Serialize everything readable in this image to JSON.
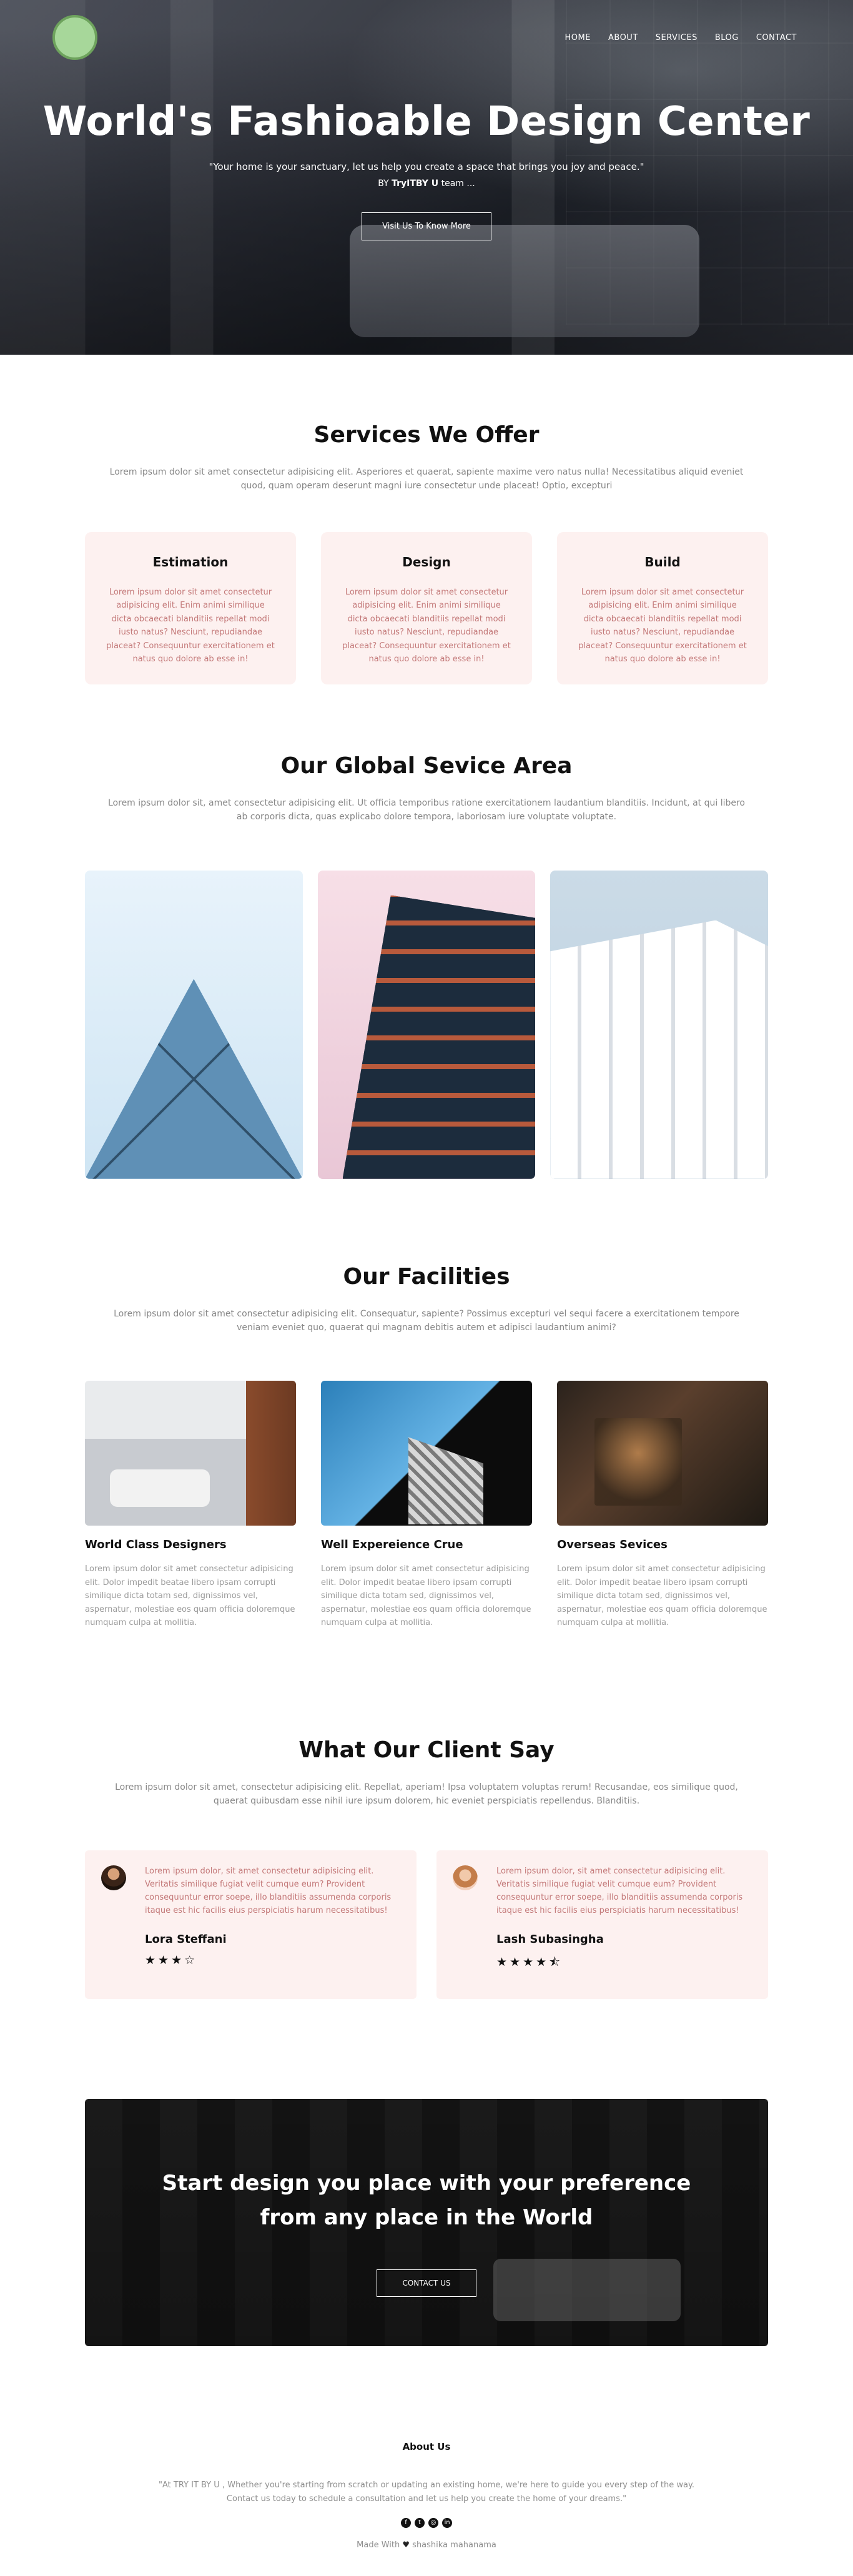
{
  "nav": {
    "logo_text": "",
    "links": [
      "HOME",
      "ABOUT",
      "SERVICES",
      "BLOG",
      "CONTACT"
    ]
  },
  "hero": {
    "title": "World's Fashioable Design Center",
    "quote": "\"Your home is your sanctuary, let us help you create a space that brings you joy and peace.\"",
    "by_prefix": "BY",
    "by_brand": "TryITBY U",
    "by_suffix": "team ...",
    "button": "Visit Us To Know More"
  },
  "services": {
    "title": "Services We Offer",
    "lead": "Lorem ipsum dolor sit amet consectetur adipisicing elit. Asperiores et quaerat, sapiente maxime vero natus nulla! Necessitatibus aliquid eveniet quod, quam operam deserunt magni iure consectetur unde placeat! Optio, excepturi",
    "cards": [
      {
        "title": "Estimation",
        "text": "Lorem ipsum dolor sit amet consectetur adipisicing elit. Enim animi similique dicta obcaecati blanditiis repellat modi iusto natus? Nesciunt, repudiandae placeat? Consequuntur exercitationem et natus quo dolore ab esse in!"
      },
      {
        "title": "Design",
        "text": "Lorem ipsum dolor sit amet consectetur adipisicing elit. Enim animi similique dicta obcaecati blanditiis repellat modi iusto natus? Nesciunt, repudiandae placeat? Consequuntur exercitationem et natus quo dolore ab esse in!"
      },
      {
        "title": "Build",
        "text": "Lorem ipsum dolor sit amet consectetur adipisicing elit. Enim animi similique dicta obcaecati blanditiis repellat modi iusto natus? Nesciunt, repudiandae placeat? Consequuntur exercitationem et natus quo dolore ab esse in!"
      }
    ]
  },
  "area": {
    "title": "Our Global Sevice Area",
    "lead": "Lorem ipsum dolor sit, amet consectetur adipisicing elit. Ut officia temporibus ratione exercitationem laudantium blanditiis. Incidunt, at qui libero ab corporis dicta, quas explicabo dolore tempora, laboriosam iure voluptate voluptate."
  },
  "facilities": {
    "title": "Our Facilities",
    "lead": "Lorem ipsum dolor sit amet consectetur adipisicing elit. Consequatur, sapiente? Possimus excepturi vel sequi facere a exercitationem tempore veniam eveniet quo, quaerat qui magnam debitis autem et adipisci laudantium animi?",
    "items": [
      {
        "title": "World Class Designers",
        "text": "Lorem ipsum dolor sit amet consectetur adipisicing elit. Dolor impedit beatae libero ipsam corrupti similique dicta totam sed, dignissimos vel, aspernatur, molestiae eos quam officia doloremque numquam culpa at mollitia."
      },
      {
        "title": "Well Expereience Crue",
        "text": "Lorem ipsum dolor sit amet consectetur adipisicing elit. Dolor impedit beatae libero ipsam corrupti similique dicta totam sed, dignissimos vel, aspernatur, molestiae eos quam officia doloremque numquam culpa at mollitia."
      },
      {
        "title": "Overseas Sevices",
        "text": "Lorem ipsum dolor sit amet consectetur adipisicing elit. Dolor impedit beatae libero ipsam corrupti similique dicta totam sed, dignissimos vel, aspernatur, molestiae eos quam officia doloremque numquam culpa at mollitia."
      }
    ]
  },
  "clients": {
    "title": "What Our Client Say",
    "lead": "Lorem ipsum dolor sit amet, consectetur adipisicing elit. Repellat, aperiam! Ipsa voluptatem voluptas rerum! Recusandae, eos similique quod, quaerat quibusdam esse nihil iure ipsum dolorem, hic eveniet perspiciatis repellendus. Blanditiis.",
    "items": [
      {
        "text": "Lorem ipsum dolor, sit amet consectetur adipisicing elit. Veritatis similique fugiat velit cumque eum? Provident consequuntur error soepe, illo blanditiis assumenda corporis itaque est hic facilis eius perspiciatis harum necessitatibus!",
        "name": "Lora Steffani",
        "stars": "★★★☆"
      },
      {
        "text": "Lorem ipsum dolor, sit amet consectetur adipisicing elit. Veritatis similique fugiat velit cumque eum? Provident consequuntur error soepe, illo blanditiis assumenda corporis itaque est hic facilis eius perspiciatis harum necessitatibus!",
        "name": "Lash Subasingha",
        "stars": "★★★★⯪"
      }
    ]
  },
  "cta": {
    "title_line1": "Start design you place with your preference",
    "title_line2": "from any place in the World",
    "button": "CONTACT US"
  },
  "footer": {
    "title": "About Us",
    "about": "\"At TRY IT BY U , Whether you're starting from scratch or updating an existing home, we're here to guide you every step of the way. Contact us today to schedule a consultation and let us help you create the home of your dreams.\"",
    "made_prefix": "Made With",
    "made_suffix": "shashika mahanama",
    "socials": [
      "facebook-icon",
      "twitter-icon",
      "instagram-icon",
      "linkedin-icon"
    ]
  },
  "colors": {
    "card_bg": "#fdf1f0",
    "accent_text": "#c47a7a",
    "logo_green": "#a7d79a"
  }
}
